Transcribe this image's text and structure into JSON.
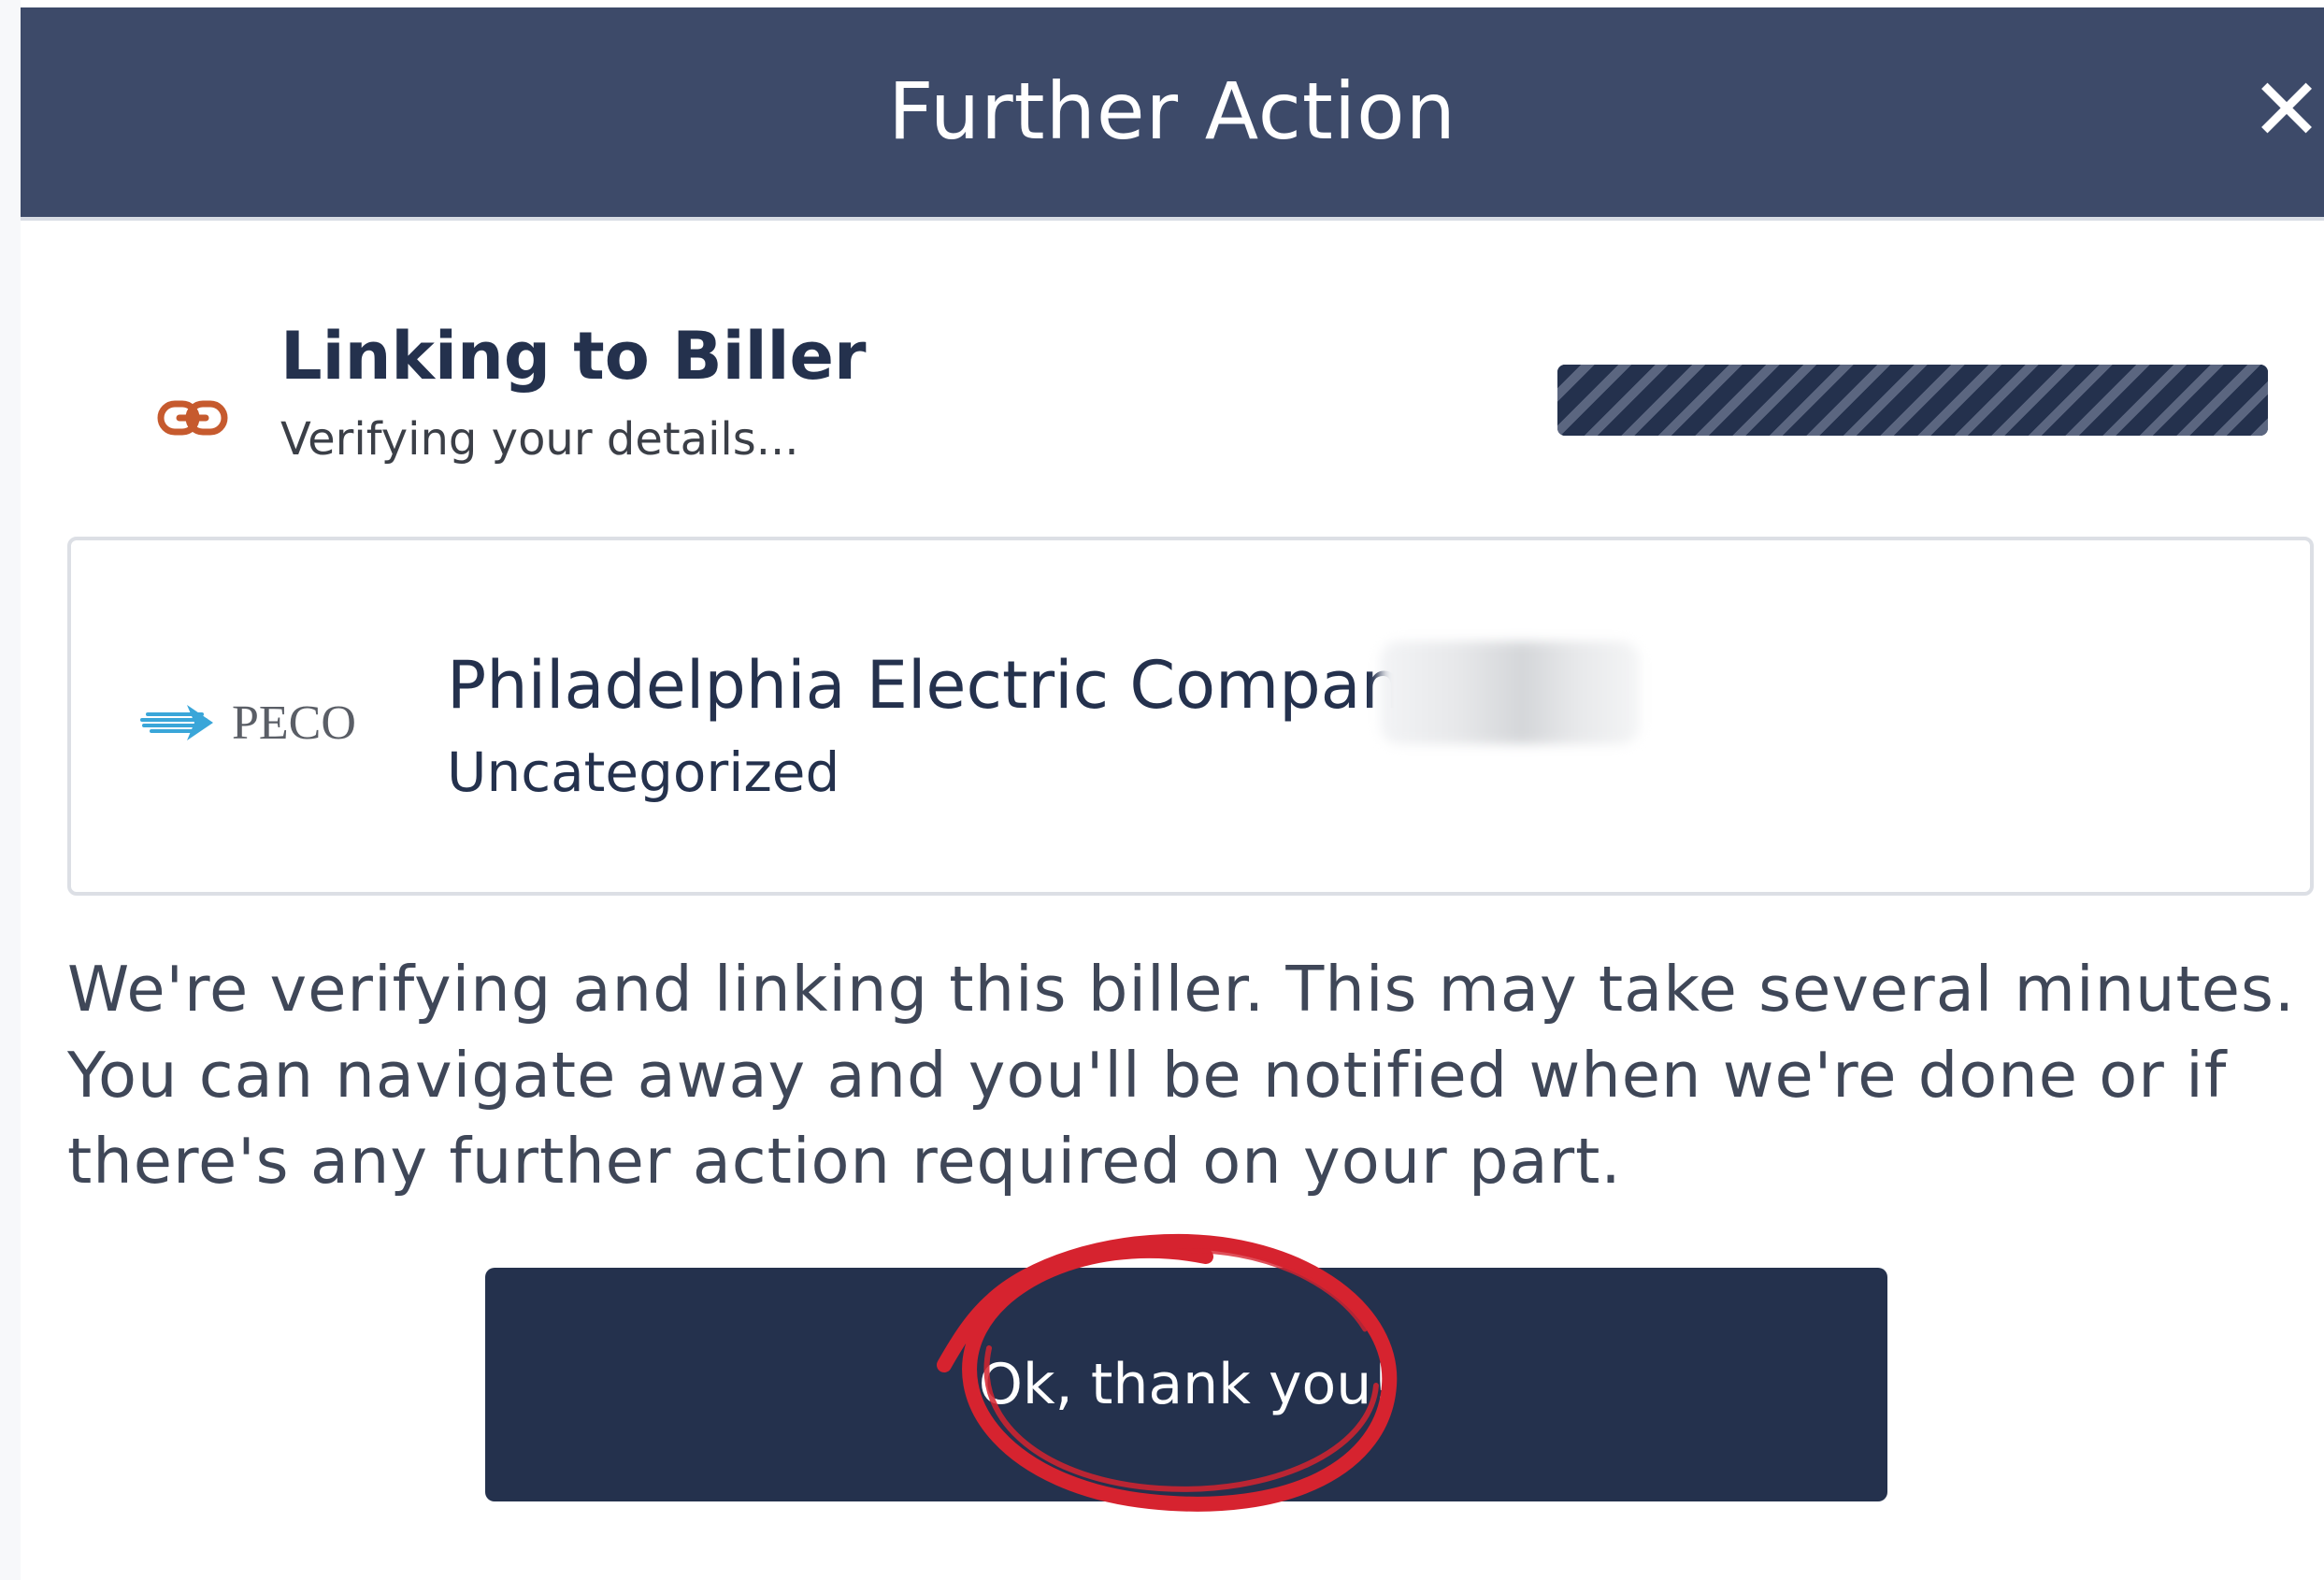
{
  "modal": {
    "title": "Further Action",
    "close_icon": "close-icon",
    "close_glyph": "✕"
  },
  "status": {
    "icon": "link-icon",
    "icon_color": "#c65a2e",
    "title": "Linking to Biller",
    "subtitle": "Verifying your details...",
    "progress_percent": 100
  },
  "biller": {
    "logo": {
      "icon": "peco-logo-icon",
      "text": "PECO",
      "accent_color": "#3aa6d9"
    },
    "name": "Philadelphia Electric Company",
    "category": "Uncategorized"
  },
  "message": "We're verifying and linking this biller. This may take several minutes. You can navigate away and you'll be notified when we're done or if there's any further action required on your part.",
  "actions": {
    "confirm_label": "Ok, thank you!"
  },
  "annotation": {
    "icon": "red-circle-annotation",
    "color": "#d6232f"
  },
  "colors": {
    "header_bg": "#3d4a69",
    "primary": "#24314d",
    "text": "#3f4758"
  }
}
